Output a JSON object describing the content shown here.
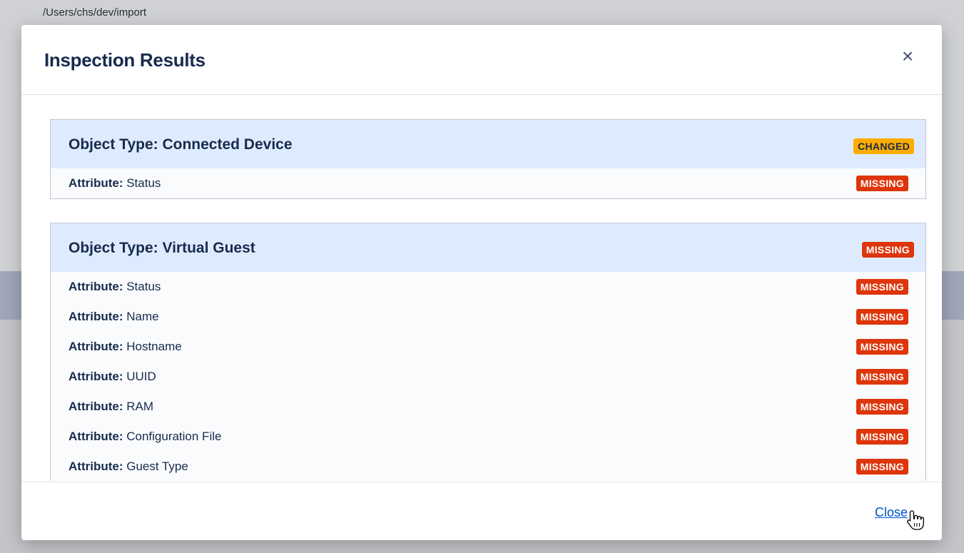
{
  "background": {
    "path": "/Users/chs/dev/import"
  },
  "modal": {
    "title": "Inspection Results",
    "close_icon": "×",
    "footer_close_label": "Close"
  },
  "colors": {
    "missing": "#de350b",
    "changed": "#ffab00",
    "panel_header": "#deebff",
    "link": "#0052cc"
  },
  "object_types": [
    {
      "title": "Object Type: Connected Device",
      "status": "CHANGED",
      "attributes": [
        {
          "label": "Attribute:",
          "name": "Status",
          "status": "MISSING"
        }
      ]
    },
    {
      "title": "Object Type: Virtual Guest",
      "status": "MISSING",
      "attributes": [
        {
          "label": "Attribute:",
          "name": "Status",
          "status": "MISSING"
        },
        {
          "label": "Attribute:",
          "name": "Name",
          "status": "MISSING"
        },
        {
          "label": "Attribute:",
          "name": "Hostname",
          "status": "MISSING"
        },
        {
          "label": "Attribute:",
          "name": "UUID",
          "status": "MISSING"
        },
        {
          "label": "Attribute:",
          "name": "RAM",
          "status": "MISSING"
        },
        {
          "label": "Attribute:",
          "name": "Configuration File",
          "status": "MISSING"
        },
        {
          "label": "Attribute:",
          "name": "Guest Type",
          "status": "MISSING"
        }
      ]
    }
  ]
}
